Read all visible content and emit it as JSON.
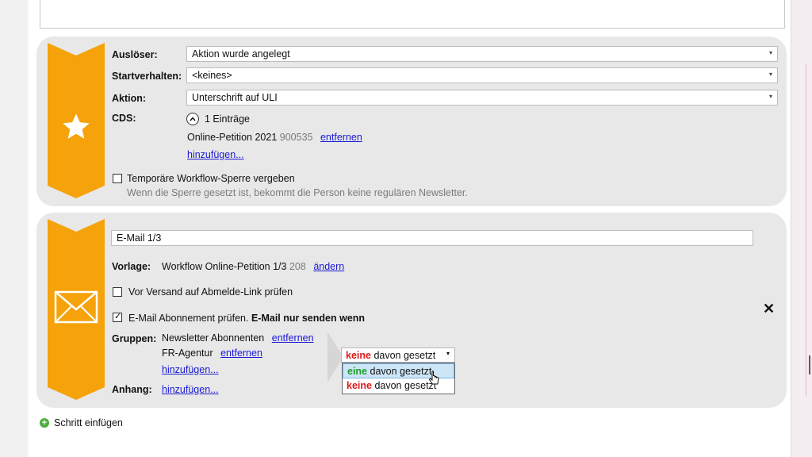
{
  "trigger_step": {
    "ausloeser_label": "Auslöser:",
    "ausloeser_value": "Aktion wurde angelegt",
    "startverhalten_label": "Startverhalten:",
    "startverhalten_value": "<keines>",
    "aktion_label": "Aktion:",
    "aktion_value": "Unterschrift auf ULI",
    "cds_label": "CDS:",
    "cds_count": "1 Einträge",
    "cds_item_name": "Online-Petition 2021",
    "cds_item_id": "900535",
    "cds_remove": "entfernen",
    "cds_add": "hinzufügen...",
    "lock_label": "Temporäre Workflow-Sperre vergeben",
    "lock_checked": false,
    "lock_hint": "Wenn die Sperre gesetzt ist, bekommt die Person keine regulären Newsletter."
  },
  "email_step": {
    "name_value": "E-Mail 1/3",
    "vorlage_label": "Vorlage:",
    "vorlage_value": "Workflow Online-Petition 1/3",
    "vorlage_id": "208",
    "vorlage_change": "ändern",
    "unsubscribe_check_label": "Vor Versand auf Abmelde-Link prüfen",
    "unsubscribe_checked": false,
    "subscription_check_label": "E-Mail Abonnement prüfen.",
    "subscription_check_bold": "E-Mail nur senden wenn",
    "subscription_checked": true,
    "gruppen_label": "Gruppen:",
    "groups": [
      {
        "name": "Newsletter Abonnenten",
        "remove": "entfernen"
      },
      {
        "name": "FR-Agentur",
        "remove": "entfernen"
      }
    ],
    "groups_add": "hinzufügen...",
    "anhang_label": "Anhang:",
    "anhang_add": "hinzufügen...",
    "close_symbol": "✕",
    "condition": {
      "selected_strong": "keine",
      "selected_rest": "davon gesetzt",
      "options": [
        {
          "strong": "eine",
          "rest": "davon gesetzt",
          "color": "#1e9e2a",
          "hovered": true
        },
        {
          "strong": "keine",
          "rest": "davon gesetzt",
          "color": "#e01b1b",
          "hovered": false
        }
      ]
    }
  },
  "add_step_label": "Schritt einfügen",
  "icons": {
    "trigger": "star-icon",
    "email": "envelope-icon",
    "expand": "chevron-up-icon",
    "add": "plus-circle-icon"
  },
  "colors": {
    "banner": "#f6a20a",
    "card_bg": "#e8e8e8",
    "link": "#1a1ad6",
    "red": "#e01b1b",
    "green": "#1e9e2a"
  }
}
